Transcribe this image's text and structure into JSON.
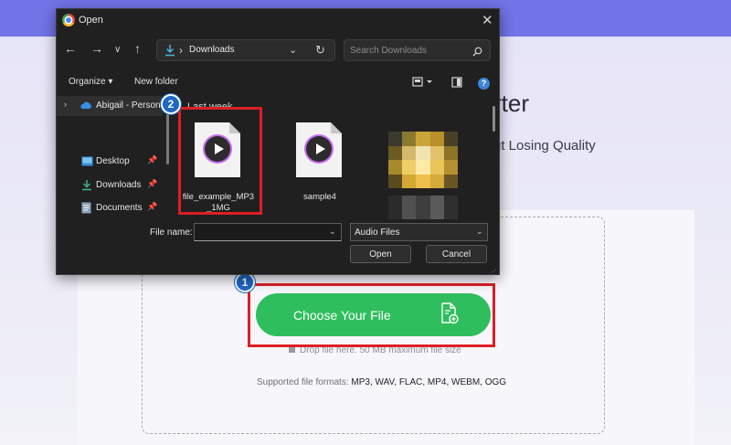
{
  "web": {
    "heading": "rter",
    "subheading": "ut Losing Quality",
    "choose_button": "Choose Your File",
    "drop_hint": "Drop file here. 50 MB maximum file size",
    "formats_label": "Supported file formats:",
    "formats_list": "MP3, WAV, FLAC, MP4, WEBM, OGG"
  },
  "annotations": {
    "badge1": "1",
    "badge2": "2",
    "highlight_color": "#dd1f26",
    "badge_color": "#1d67c6"
  },
  "dialog": {
    "title": "Open",
    "address": {
      "path": "Downloads"
    },
    "search": {
      "placeholder": "Search Downloads"
    },
    "commands": {
      "organize": "Organize",
      "new_folder": "New folder"
    },
    "nav": {
      "items": [
        {
          "label": "Abigail - Person",
          "icon": "cloud-icon"
        },
        {
          "label": "Desktop",
          "icon": "desktop-icon"
        },
        {
          "label": "Downloads",
          "icon": "download-icon"
        },
        {
          "label": "Documents",
          "icon": "documents-icon"
        }
      ]
    },
    "files": {
      "group": "Last week",
      "items": [
        {
          "name": "file_example_MP3_1MG",
          "icon": "audio-file-icon"
        },
        {
          "name": "sample4",
          "icon": "audio-file-icon"
        }
      ]
    },
    "file_name_label": "File name:",
    "file_name_value": "",
    "file_type": "Audio Files",
    "open_button": "Open",
    "cancel_button": "Cancel"
  },
  "colors": {
    "accent_green": "#2fbe5d",
    "top_bar": "#7173e6",
    "dialog_bg": "#202020"
  }
}
